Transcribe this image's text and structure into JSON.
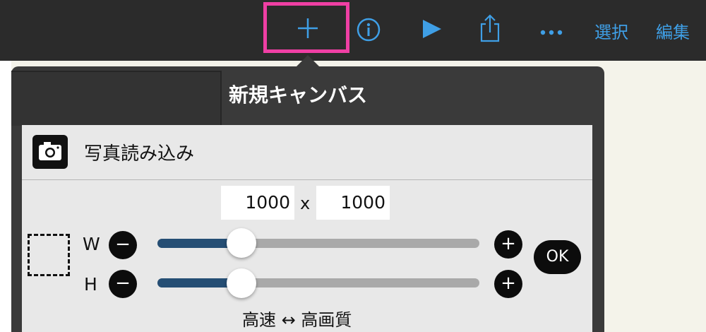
{
  "toolbar": {
    "add_icon": "plus-icon",
    "info_icon": "info-icon",
    "play_icon": "play-icon",
    "share_icon": "share-icon",
    "more_icon": "more-icon",
    "select_label": "選択",
    "edit_label": "編集"
  },
  "popover": {
    "title": "新規キャンバス",
    "photo_import": {
      "icon": "camera-icon",
      "label": "写真読み込み"
    },
    "width_value": "1000",
    "height_value": "1000",
    "separator": "x",
    "w_label": "W",
    "h_label": "H",
    "w_slider_fraction": 0.26,
    "h_slider_fraction": 0.26,
    "ok_label": "OK",
    "quality_label": "高速 ↔ 高画質"
  },
  "colors": {
    "accent": "#3f9fe6",
    "highlight": "#ef3fa4",
    "toolbar_bg": "#2b2b2b",
    "slider_fill": "#254e74"
  }
}
